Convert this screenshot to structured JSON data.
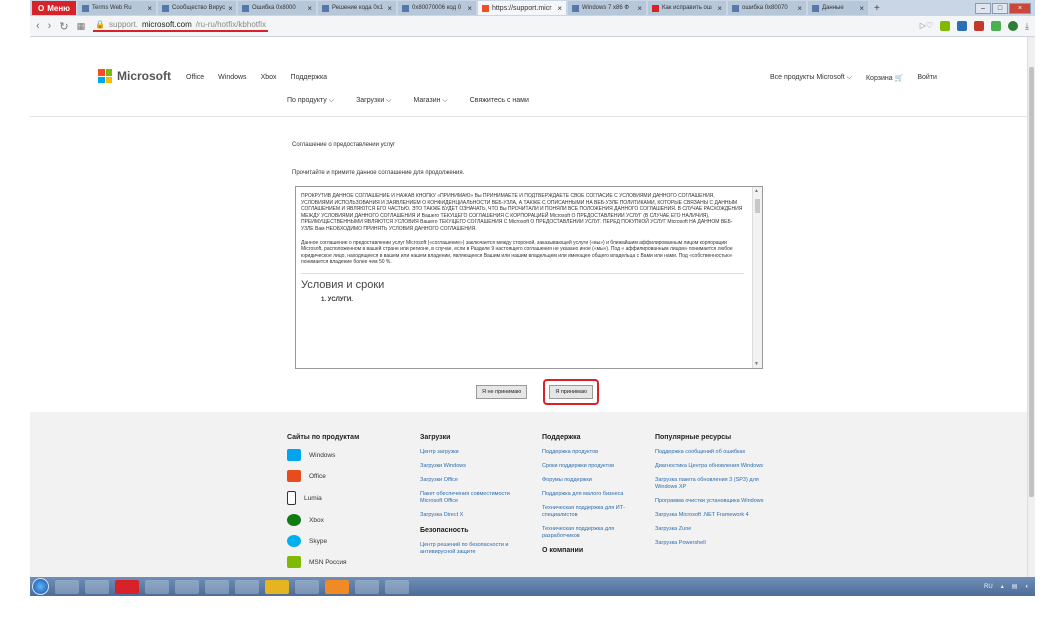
{
  "browser": {
    "menu_label": "Меню",
    "tabs": [
      {
        "title": "Terms Web Ru"
      },
      {
        "title": "Сообщество Вирус"
      },
      {
        "title": "Ошибка 0x8000"
      },
      {
        "title": "Решение кода 0x1"
      },
      {
        "title": "0x80070006 код 0"
      },
      {
        "title": "https://support.micr",
        "active": true
      },
      {
        "title": "Windows 7 x86 Ф"
      },
      {
        "title": "Как исправить ош"
      },
      {
        "title": "ошибка 0x80070"
      },
      {
        "title": "Данные"
      }
    ],
    "url_prefix": "support.",
    "url_domain": "microsoft.com",
    "url_path": "/ru-ru/hotfix/kbhotfix"
  },
  "header": {
    "logo_text": "Microsoft",
    "topnav": [
      "Office",
      "Windows",
      "Xbox",
      "Поддержка"
    ],
    "rightnav": [
      "Все продукты Microsoft ⌵",
      "Корзина",
      "Войти"
    ],
    "subnav": [
      "По продукту ⌵",
      "Загрузки ⌵",
      "Магазин ⌵",
      "Свяжитесь с нами"
    ]
  },
  "main": {
    "title": "Соглашение о предоставлении услуг",
    "instruction": "Прочитайте и примите данное соглашение для продолжения.",
    "agreement_p1": "ПРОКРУТИВ ДАННОЕ СОГЛАШЕНИЕ И НАЖАВ КНОПКУ «ПРИНИМАЮ» Вы ПРИНИМАЕТЕ И ПОДТВЕРЖДАЕТЕ СВОЕ СОГЛАСИЕ С УСЛОВИЯМИ ДАННОГО СОГЛАШЕНИЯ, УСЛОВИЯМИ ИСПОЛЬЗОВАНИЯ И ЗАЯВЛЕНИЕМ О КОНФИДЕНЦИАЛЬНОСТИ ВЕБ-УЗЛА, А ТАКЖЕ С ОПИСАННЫМИ НА ВЕБ-УЗЛЕ ПОЛИТИКАМИ, КОТОРЫЕ СВЯЗАНЫ С ДАННЫМ СОГЛАШЕНИЕМ И ЯВЛЯЮТСЯ ЕГО ЧАСТЬЮ. ЭТО ТАКЖЕ БУДЕТ ОЗНАЧАТЬ, ЧТО Вы ПРОЧИТАЛИ И ПОНЯЛИ ВСЕ ПОЛОЖЕНИЯ ДАННОГО СОГЛАШЕНИЯ. В СЛУЧАЕ РАСХОЖДЕНИЯ МЕЖДУ УСЛОВИЯМИ ДАННОГО СОГЛАШЕНИЯ И Вашего ТЕКУЩЕГО СОГЛАШЕНИЯ С КОРПОРАЦИЕЙ Microsoft О ПРЕДОСТАВЛЕНИИ УСЛУГ (В СЛУЧАЕ ЕГО НАЛИЧИЯ), ПРЕИМУЩЕСТВЕННЫМИ ЯВЛЯЮТСЯ УСЛОВИЯ Вашего ТЕКУЩЕГО СОГЛАШЕНИЯ С Microsoft О ПРЕДОСТАВЛЕНИИ УСЛУГ. ПЕРЕД ПОКУПКОЙ УСЛУГ Microsoft НА ДАННОМ ВЕБ-УЗЛЕ Вам НЕОБХОДИМО ПРИНЯТЬ УСЛОВИЯ ДАННОГО СОГЛАШЕНИЯ.",
    "agreement_p2": "Данное соглашение о предоставлении услуг Microsoft («соглашение») заключается между стороной, заказывающей услуги («вы») и ближайшим аффилированным лицом корпорации Microsoft, расположенном в вашей стране или регионе, в случае, если в Разделе 9 настоящего соглашения не указано иное («мы»). Под « аффилированным лицом» понимается любое юридическое лицо, находящееся в вашем или нашем владении, являющееся Вашим или нашим владельцем или имеющее общего владельца с Вами или нами. Под «собственностью» понимается владение более чем 50 %.",
    "terms_title": "Условия и сроки",
    "item1": "1. УСЛУГИ.",
    "decline_label": "Я не принимаю",
    "accept_label": "Я принимаю"
  },
  "footer": {
    "col1": {
      "title": "Сайты по продуктам",
      "items": [
        "Windows",
        "Office",
        "Lumia",
        "Xbox",
        "Skype",
        "MSN Россия"
      ]
    },
    "col2": {
      "title": "Загрузки",
      "items": [
        "Центр загрузки",
        "Загрузки Windows",
        "Загрузки Office",
        "Пакет обеспечения совместимости Microsoft Office",
        "Загрузка Direct X"
      ],
      "title2": "Безопасность",
      "items2": [
        "Центр решений по безопасности и антивирусной защите"
      ]
    },
    "col3": {
      "title": "Поддержка",
      "items": [
        "Поддержка продуктов",
        "Сроки поддержки продуктов",
        "Форумы поддержки",
        "Поддержка для малого бизнеса",
        "Техническая поддержка для ИТ-специалистов",
        "Техническая поддержка для разработчиков"
      ],
      "title2": "О компании"
    },
    "col4": {
      "title": "Популярные ресурсы",
      "items": [
        "Поддержка сообщений об ошибках",
        "Диагностика Центра обновления Windows",
        "Загрузка пакета обновления 3 (SP3) для Windows XP",
        "Программа очистки установщика Windows",
        "Загрузка Microsoft .NET Framework 4",
        "Загрузка Zune",
        "Загрузка Powershell"
      ]
    }
  },
  "taskbar": {
    "lang": "RU"
  },
  "colors": {
    "accent_red": "#d8222a",
    "link_blue": "#2b6cb0",
    "ms_red": "#f25022",
    "ms_green": "#7fba00",
    "ms_blue": "#00a4ef",
    "ms_yellow": "#ffb900"
  }
}
